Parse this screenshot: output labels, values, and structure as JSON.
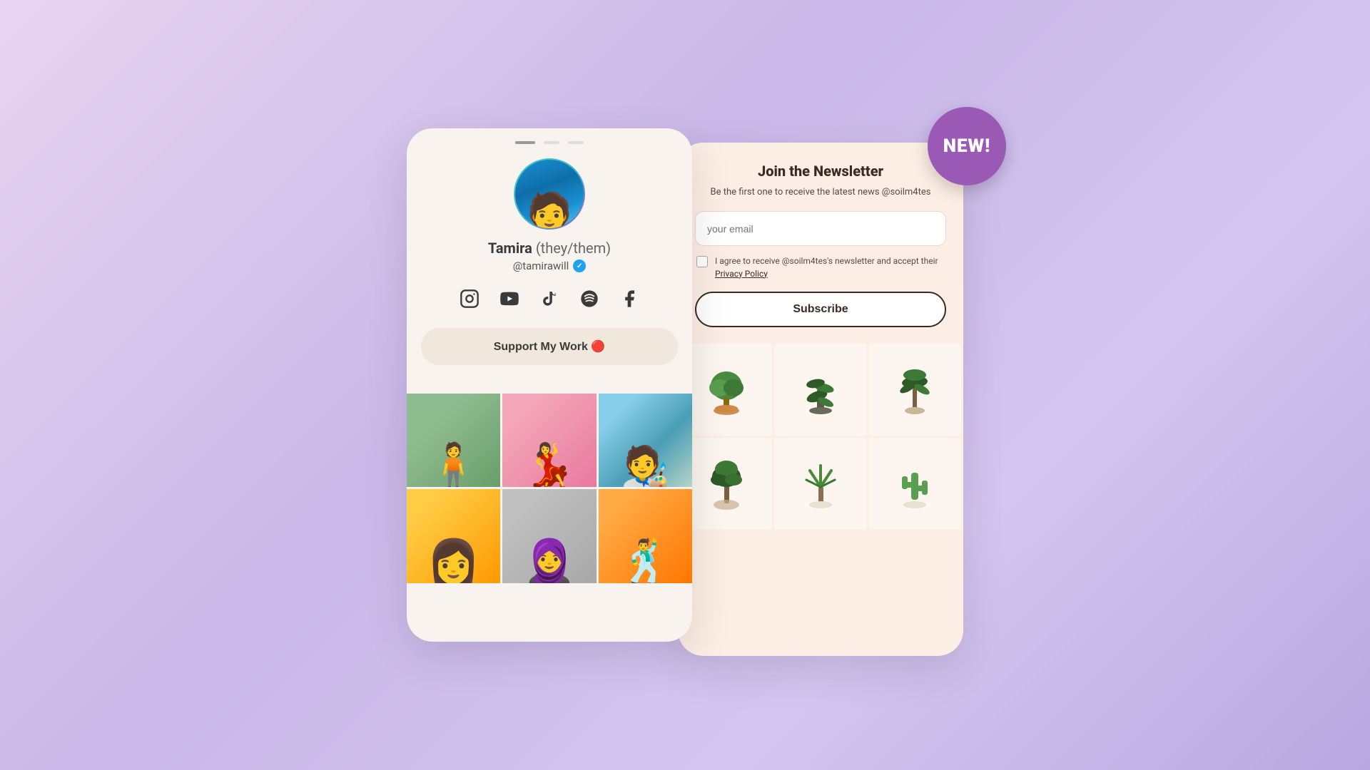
{
  "background": {
    "gradient_start": "#e8d5f0",
    "gradient_end": "#b8a8e0"
  },
  "left_card": {
    "notch_bars": [
      "active",
      "inactive",
      "inactive"
    ],
    "profile": {
      "name": "Tamira",
      "pronouns": "(they/them)",
      "handle": "@tamirawill",
      "verified": true
    },
    "social_icons": [
      {
        "name": "instagram-icon",
        "symbol": "📷"
      },
      {
        "name": "youtube-icon",
        "symbol": "▶"
      },
      {
        "name": "tiktok-icon",
        "symbol": "♪"
      },
      {
        "name": "spotify-icon",
        "symbol": "🎵"
      },
      {
        "name": "facebook-icon",
        "symbol": "f"
      }
    ],
    "support_button_label": "Support My Work 🔴",
    "photos": [
      {
        "label": "photo-1",
        "color_class": "photo-1"
      },
      {
        "label": "photo-2",
        "color_class": "photo-2"
      },
      {
        "label": "photo-3",
        "color_class": "photo-3"
      },
      {
        "label": "photo-4",
        "color_class": "photo-4"
      },
      {
        "label": "photo-5",
        "color_class": "photo-5"
      },
      {
        "label": "photo-6",
        "color_class": "photo-6"
      }
    ]
  },
  "right_card": {
    "new_badge_label": "NEW!",
    "newsletter": {
      "title": "Join the Newsletter",
      "description": "Be the first one to receive the latest news @soilm4tes",
      "email_placeholder": "your email",
      "checkbox_text": "I agree to receive @soilm4tes's newsletter and accept their ",
      "privacy_policy_label": "Privacy Policy",
      "subscribe_button_label": "Subscribe"
    },
    "plants": [
      {
        "label": "plant-1",
        "emoji": "🌱"
      },
      {
        "label": "plant-2",
        "emoji": "🌿"
      },
      {
        "label": "plant-3",
        "emoji": "🪴"
      },
      {
        "label": "plant-4",
        "emoji": "🌳"
      },
      {
        "label": "plant-5",
        "emoji": "🎋"
      },
      {
        "label": "plant-6",
        "emoji": "🌵"
      }
    ]
  }
}
